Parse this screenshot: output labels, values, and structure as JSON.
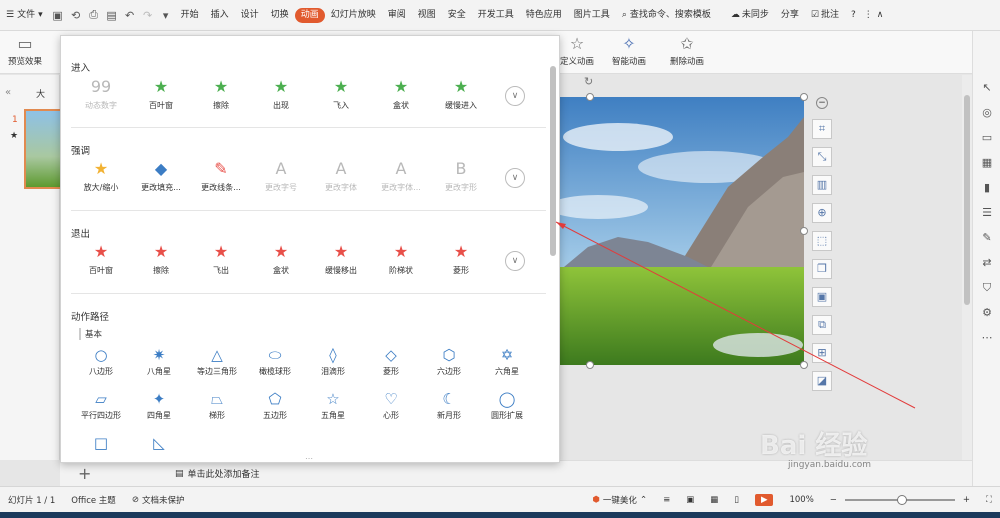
{
  "menubar": {
    "file": "文件",
    "tabs": [
      "开始",
      "插入",
      "设计",
      "切换",
      "动画",
      "幻灯片放映",
      "审阅",
      "视图",
      "安全",
      "开发工具",
      "特色应用",
      "图片工具"
    ],
    "active_tab": "动画",
    "search": "查找命令、搜索模板",
    "sync": "未同步",
    "share": "分享",
    "comment": "批注",
    "help": "?"
  },
  "ribbon": {
    "preview": "预览效果",
    "custom_anim": "定义动画",
    "smart_anim": "智能动画",
    "delete_anim": "删除动画"
  },
  "leftpanel": {
    "tab_label": "大",
    "slide_number": "1"
  },
  "dropdown": {
    "enter": {
      "title": "进入",
      "items": [
        {
          "label": "动态数字",
          "disabled": true,
          "icon": "99"
        },
        {
          "label": "百叶窗",
          "disabled": false,
          "icon": "★"
        },
        {
          "label": "擦除",
          "disabled": false,
          "icon": "★"
        },
        {
          "label": "出现",
          "disabled": false,
          "icon": "★"
        },
        {
          "label": "飞入",
          "disabled": false,
          "icon": "★"
        },
        {
          "label": "盒状",
          "disabled": false,
          "icon": "★"
        },
        {
          "label": "缓慢进入",
          "disabled": false,
          "icon": "★"
        }
      ]
    },
    "emphasis": {
      "title": "强调",
      "items": [
        {
          "label": "放大/缩小",
          "disabled": false,
          "icon": "★"
        },
        {
          "label": "更改填充...",
          "disabled": false,
          "icon": "◆"
        },
        {
          "label": "更改线条...",
          "disabled": false,
          "icon": "✎"
        },
        {
          "label": "更改字号",
          "disabled": true,
          "icon": "A"
        },
        {
          "label": "更改字体",
          "disabled": true,
          "icon": "A"
        },
        {
          "label": "更改字体...",
          "disabled": true,
          "icon": "A"
        },
        {
          "label": "更改字形",
          "disabled": true,
          "icon": "B"
        }
      ]
    },
    "exit": {
      "title": "退出",
      "items": [
        {
          "label": "百叶窗",
          "disabled": false,
          "icon": "★"
        },
        {
          "label": "擦除",
          "disabled": false,
          "icon": "★"
        },
        {
          "label": "飞出",
          "disabled": false,
          "icon": "★"
        },
        {
          "label": "盒状",
          "disabled": false,
          "icon": "★"
        },
        {
          "label": "缓慢移出",
          "disabled": false,
          "icon": "★"
        },
        {
          "label": "阶梯状",
          "disabled": false,
          "icon": "★"
        },
        {
          "label": "菱形",
          "disabled": false,
          "icon": "★"
        }
      ]
    },
    "paths": {
      "title": "动作路径",
      "subtitle": "基本",
      "row1": [
        "八边形",
        "八角星",
        "等边三角形",
        "橄榄球形",
        "泪滴形",
        "菱形",
        "六边形",
        "六角星"
      ],
      "row1_icons": [
        "○",
        "✷",
        "△",
        "⬭",
        "◊",
        "◇",
        "⬡",
        "✡"
      ],
      "row2": [
        "平行四边形",
        "四角星",
        "梯形",
        "五边形",
        "五角星",
        "心形",
        "新月形",
        "圆形扩展"
      ],
      "row2_icons": [
        "▱",
        "✦",
        "⏢",
        "⬠",
        "☆",
        "♡",
        "☾",
        "◯"
      ],
      "row3_icons": [
        "□",
        "◺"
      ]
    }
  },
  "notes": {
    "placeholder": "单击此处添加备注"
  },
  "statusbar": {
    "slide": "幻灯片 1 / 1",
    "theme": "Office 主题",
    "protect": "文档未保护",
    "beautify": "一键美化",
    "zoom": "100%"
  },
  "watermark": {
    "text": "Bai 经验",
    "sub": "jingyan.baidu.com"
  },
  "colors": {
    "accent": "#e15a2e",
    "path_blue": "#3c7dc4",
    "star_green": "#4caf50",
    "star_red": "#e8504a",
    "star_gold": "#f2b233"
  }
}
